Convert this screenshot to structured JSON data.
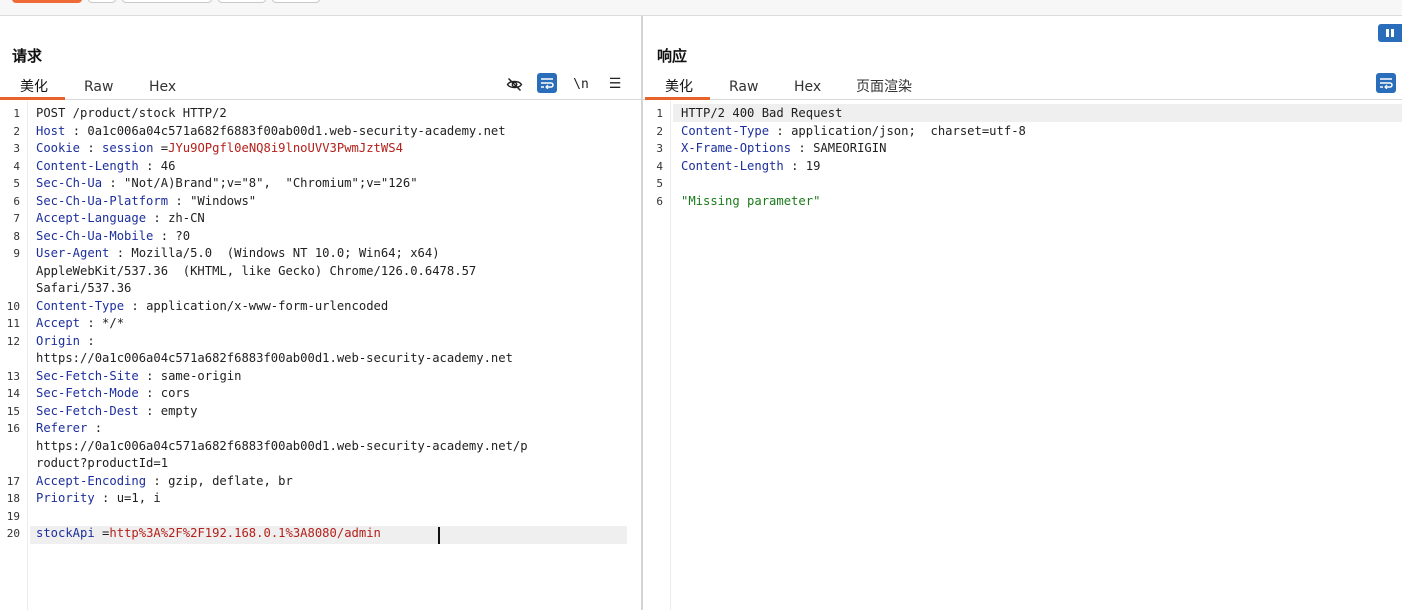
{
  "request": {
    "title": "请求",
    "tabs": [
      {
        "label": "美化",
        "active": true
      },
      {
        "label": "Raw",
        "active": false
      },
      {
        "label": "Hex",
        "active": false
      }
    ],
    "tools": [
      "eye-off-icon",
      "wrap-icon",
      "newline-icon",
      "menu-icon"
    ],
    "newline_glyph": "\\n",
    "menu_glyph": "☰",
    "lines": [
      {
        "n": "1",
        "parts": [
          {
            "t": "POST /product/stock HTTP/2",
            "c": ""
          }
        ]
      },
      {
        "n": "2",
        "parts": [
          {
            "t": "Host",
            "c": "hn"
          },
          {
            "t": " : 0a1c006a04c571a682f6883f00ab00d1.web-security-academy.net",
            "c": ""
          }
        ]
      },
      {
        "n": "3",
        "parts": [
          {
            "t": "Cookie",
            "c": "hn"
          },
          {
            "t": " : ",
            "c": ""
          },
          {
            "t": "session",
            "c": "hn"
          },
          {
            "t": " =",
            "c": ""
          },
          {
            "t": "JYu9OPgfl0eNQ8i9lnoUVV3PwmJztWS4",
            "c": "red"
          }
        ]
      },
      {
        "n": "4",
        "parts": [
          {
            "t": "Content-Length",
            "c": "hn"
          },
          {
            "t": " : 46",
            "c": ""
          }
        ]
      },
      {
        "n": "5",
        "parts": [
          {
            "t": "Sec-Ch-Ua",
            "c": "hn"
          },
          {
            "t": " : \"Not/A)Brand\";v=\"8\",  \"Chromium\";v=\"126\"",
            "c": ""
          }
        ]
      },
      {
        "n": "6",
        "parts": [
          {
            "t": "Sec-Ch-Ua-Platform",
            "c": "hn"
          },
          {
            "t": " : \"Windows\"",
            "c": ""
          }
        ]
      },
      {
        "n": "7",
        "parts": [
          {
            "t": "Accept-Language",
            "c": "hn"
          },
          {
            "t": " : zh-CN",
            "c": ""
          }
        ]
      },
      {
        "n": "8",
        "parts": [
          {
            "t": "Sec-Ch-Ua-Mobile",
            "c": "hn"
          },
          {
            "t": " : ?0",
            "c": ""
          }
        ]
      },
      {
        "n": "9",
        "parts": [
          {
            "t": "User-Agent",
            "c": "hn"
          },
          {
            "t": " : Mozilla/5.0  (Windows NT 10.0; Win64; x64)",
            "c": ""
          }
        ]
      },
      {
        "n": "",
        "parts": [
          {
            "t": "AppleWebKit/537.36  (KHTML, like Gecko) Chrome/126.0.6478.57",
            "c": ""
          }
        ]
      },
      {
        "n": "",
        "parts": [
          {
            "t": "Safari/537.36",
            "c": ""
          }
        ]
      },
      {
        "n": "10",
        "parts": [
          {
            "t": "Content-Type",
            "c": "hn"
          },
          {
            "t": " : application/x-www-form-urlencoded",
            "c": ""
          }
        ]
      },
      {
        "n": "11",
        "parts": [
          {
            "t": "Accept",
            "c": "hn"
          },
          {
            "t": " : */*",
            "c": ""
          }
        ]
      },
      {
        "n": "12",
        "parts": [
          {
            "t": "Origin",
            "c": "hn"
          },
          {
            "t": " :",
            "c": ""
          }
        ]
      },
      {
        "n": "",
        "parts": [
          {
            "t": "https://0a1c006a04c571a682f6883f00ab00d1.web-security-academy.net",
            "c": ""
          }
        ]
      },
      {
        "n": "13",
        "parts": [
          {
            "t": "Sec-Fetch-Site",
            "c": "hn"
          },
          {
            "t": " : same-origin",
            "c": ""
          }
        ]
      },
      {
        "n": "14",
        "parts": [
          {
            "t": "Sec-Fetch-Mode",
            "c": "hn"
          },
          {
            "t": " : cors",
            "c": ""
          }
        ]
      },
      {
        "n": "15",
        "parts": [
          {
            "t": "Sec-Fetch-Dest",
            "c": "hn"
          },
          {
            "t": " : empty",
            "c": ""
          }
        ]
      },
      {
        "n": "16",
        "parts": [
          {
            "t": "Referer",
            "c": "hn"
          },
          {
            "t": " :",
            "c": ""
          }
        ]
      },
      {
        "n": "",
        "parts": [
          {
            "t": "https://0a1c006a04c571a682f6883f00ab00d1.web-security-academy.net/p",
            "c": ""
          }
        ]
      },
      {
        "n": "",
        "parts": [
          {
            "t": "roduct?productId=1",
            "c": ""
          }
        ]
      },
      {
        "n": "17",
        "parts": [
          {
            "t": "Accept-Encoding",
            "c": "hn"
          },
          {
            "t": " : gzip, deflate, br",
            "c": ""
          }
        ]
      },
      {
        "n": "18",
        "parts": [
          {
            "t": "Priority",
            "c": "hn"
          },
          {
            "t": " : u=1, i",
            "c": ""
          }
        ]
      },
      {
        "n": "19",
        "parts": [
          {
            "t": "",
            "c": ""
          }
        ]
      },
      {
        "n": "20",
        "parts": [
          {
            "t": "stockApi",
            "c": "hn"
          },
          {
            "t": " =",
            "c": ""
          },
          {
            "t": "http%3A%2F%2F192.168.0.1%3A8080/admin",
            "c": "red"
          }
        ]
      }
    ]
  },
  "response": {
    "title": "响应",
    "tabs": [
      {
        "label": "美化",
        "active": true
      },
      {
        "label": "Raw",
        "active": false
      },
      {
        "label": "Hex",
        "active": false
      },
      {
        "label": "页面渲染",
        "active": false
      }
    ],
    "tools": [
      "wrap-icon"
    ],
    "lines": [
      {
        "n": "1",
        "parts": [
          {
            "t": "HTTP/2 400 Bad Request",
            "c": ""
          }
        ]
      },
      {
        "n": "2",
        "parts": [
          {
            "t": "Content-Type",
            "c": "hn"
          },
          {
            "t": " : application/json;  charset=utf-8",
            "c": ""
          }
        ]
      },
      {
        "n": "3",
        "parts": [
          {
            "t": "X-Frame-Options",
            "c": "hn"
          },
          {
            "t": " : SAMEORIGIN",
            "c": ""
          }
        ]
      },
      {
        "n": "4",
        "parts": [
          {
            "t": "Content-Length",
            "c": "hn"
          },
          {
            "t": " : 19",
            "c": ""
          }
        ]
      },
      {
        "n": "5",
        "parts": [
          {
            "t": "",
            "c": ""
          }
        ]
      },
      {
        "n": "6",
        "parts": [
          {
            "t": "\"Missing parameter\"",
            "c": "str"
          }
        ]
      }
    ]
  },
  "colors": {
    "accent": "#e8622e",
    "header_name": "#1d2f9c",
    "value_red": "#b5201b",
    "string_green": "#1b7a1b",
    "button_blue": "#2a6ebb"
  }
}
